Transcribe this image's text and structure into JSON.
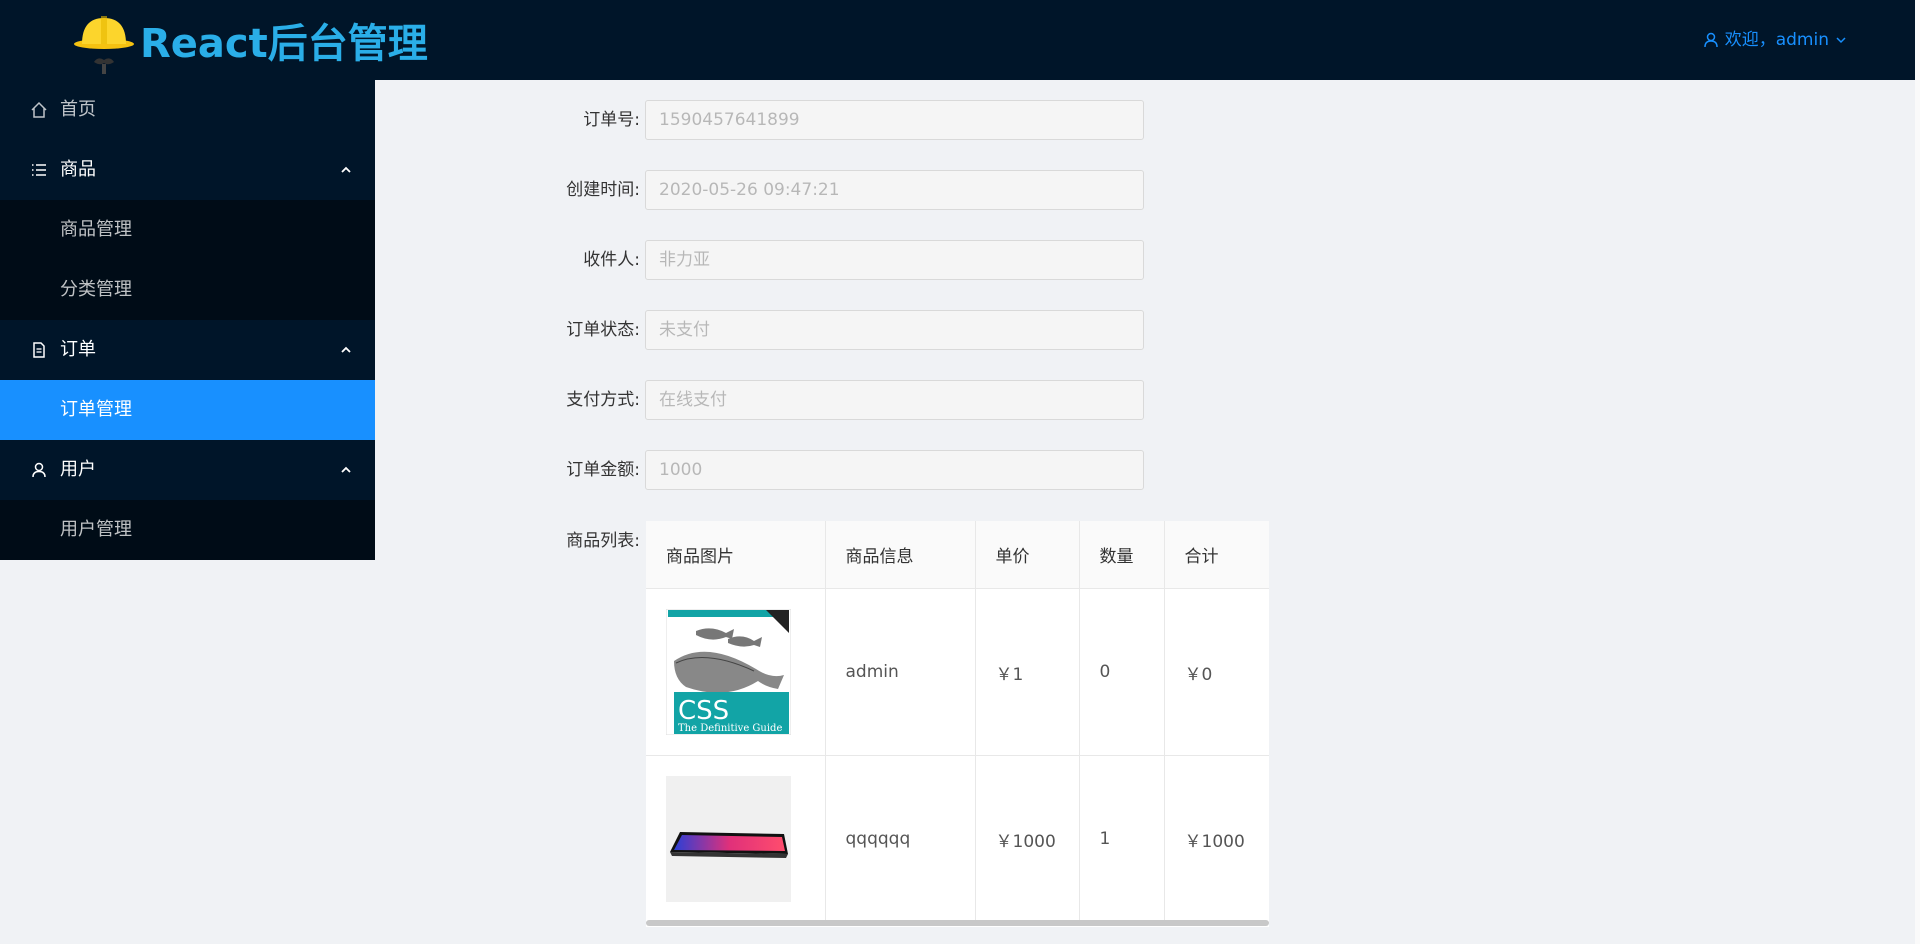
{
  "header": {
    "logo_text": "React后台管理",
    "user_greeting": "欢迎，admin"
  },
  "sidebar": {
    "items": [
      {
        "label": "首页",
        "icon": "home-icon"
      },
      {
        "label": "商品",
        "icon": "list-icon",
        "children": [
          "商品管理",
          "分类管理"
        ]
      },
      {
        "label": "订单",
        "icon": "file-icon",
        "children": [
          "订单管理"
        ]
      },
      {
        "label": "用户",
        "icon": "user-icon",
        "children": [
          "用户管理"
        ]
      }
    ],
    "selected": "订单管理"
  },
  "form": {
    "order_no_label": "订单号:",
    "order_no_value": "1590457641899",
    "created_label": "创建时间:",
    "created_value": "2020-05-26 09:47:21",
    "receiver_label": "收件人:",
    "receiver_value": "非力亚",
    "status_label": "订单状态:",
    "status_value": "未支付",
    "payment_label": "支付方式:",
    "payment_value": "在线支付",
    "amount_label": "订单金额:",
    "amount_value": "1000",
    "products_label": "商品列表:"
  },
  "table": {
    "columns": [
      "商品图片",
      "商品信息",
      "单价",
      "数量",
      "合计"
    ],
    "rows": [
      {
        "image": "css-book-cover",
        "info": "admin",
        "price": "￥1",
        "qty": "0",
        "total": "￥0"
      },
      {
        "image": "smartphone",
        "info": "qqqqqq",
        "price": "￥1000",
        "qty": "1",
        "total": "￥1000"
      }
    ]
  }
}
